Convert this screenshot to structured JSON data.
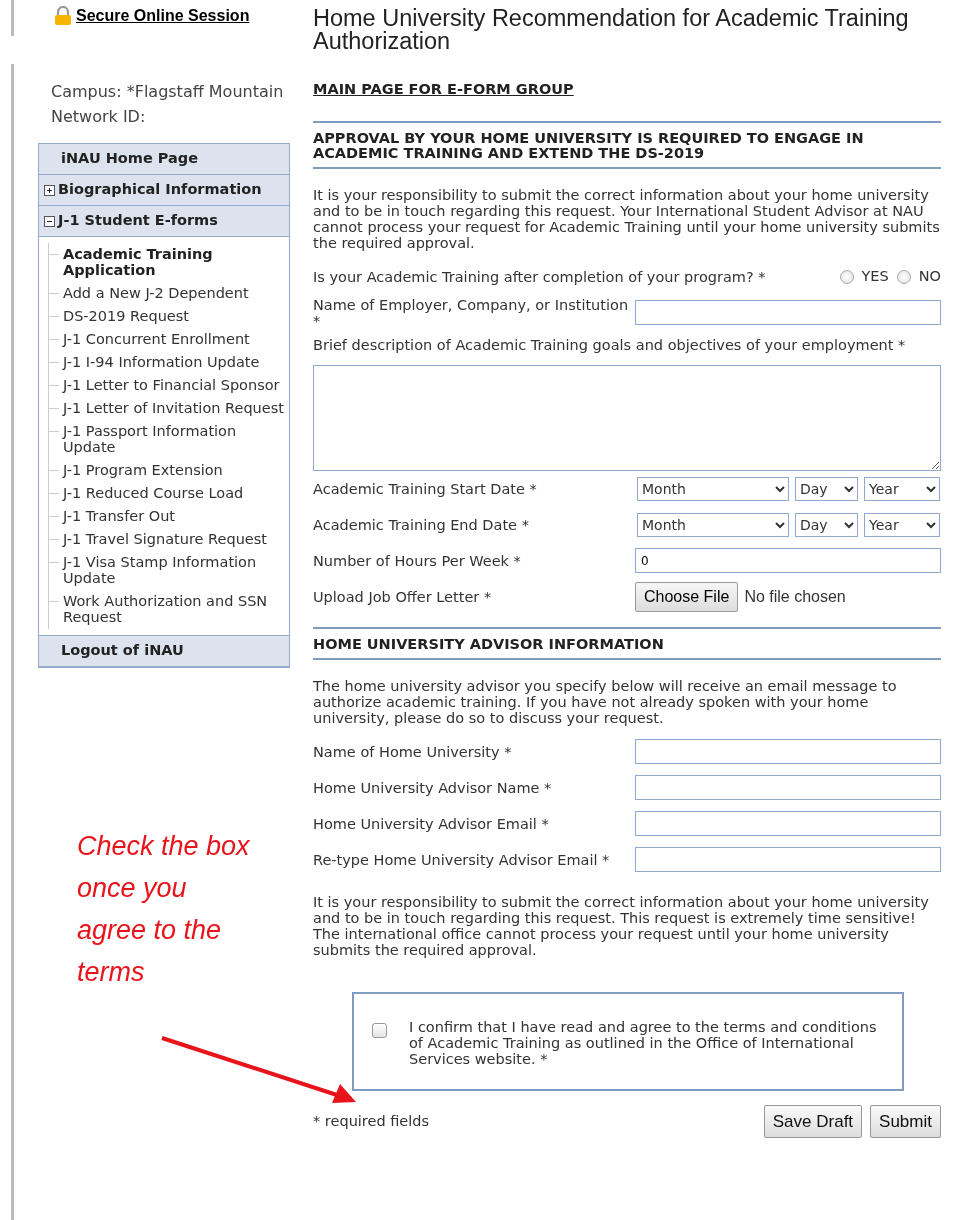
{
  "secure_session": {
    "label": "Secure Online Session"
  },
  "campus": "Campus: *Flagstaff Mountain",
  "network_id": "Network ID:",
  "sidebar": {
    "items": [
      {
        "label": "iNAU Home Page",
        "kind": "link"
      },
      {
        "label": "Biographical Information",
        "kind": "group",
        "expanded": false
      },
      {
        "label": "J-1 Student E-forms",
        "kind": "group",
        "expanded": true,
        "children": [
          {
            "label": "Academic Training Application",
            "selected": true
          },
          {
            "label": "Add a New J-2 Dependent",
            "selected": false
          },
          {
            "label": "DS-2019 Request",
            "selected": false
          },
          {
            "label": "J-1 Concurrent Enrollment",
            "selected": false
          },
          {
            "label": "J-1 I-94 Information Update",
            "selected": false
          },
          {
            "label": "J-1 Letter to Financial Sponsor",
            "selected": false
          },
          {
            "label": "J-1 Letter of Invitation Request",
            "selected": false
          },
          {
            "label": "J-1 Passport Information Update",
            "selected": false
          },
          {
            "label": "J-1 Program Extension",
            "selected": false
          },
          {
            "label": "J-1 Reduced Course Load",
            "selected": false
          },
          {
            "label": "J-1 Transfer Out",
            "selected": false
          },
          {
            "label": "J-1 Travel Signature Request",
            "selected": false
          },
          {
            "label": "J-1 Visa Stamp Information Update",
            "selected": false
          },
          {
            "label": "Work Authorization and SSN Request",
            "selected": false
          }
        ]
      },
      {
        "label": "Logout of iNAU",
        "kind": "link"
      }
    ]
  },
  "annotation": {
    "lines": [
      "Check the box",
      "once you",
      "agree to the",
      "terms"
    ]
  },
  "page_title": "Home University Recommendation for Academic Training Authorization",
  "main_link": "MAIN PAGE FOR E-FORM GROUP",
  "sections": [
    {
      "heading": "APPROVAL BY YOUR HOME UNIVERSITY IS REQUIRED TO ENGAGE IN ACADEMIC TRAINING AND EXTEND THE DS-2019",
      "intro": "It is your responsibility to submit the correct information about your home university and to be in touch regarding this request. Your International Student Advisor at NAU cannot process your request for Academic Training until your home university submits the required approval.",
      "fields": [
        {
          "kind": "radio",
          "label": "Is your Academic Training after completion of your program? *",
          "options": [
            {
              "label": "YES",
              "selected": false
            },
            {
              "label": "NO",
              "selected": false
            }
          ]
        },
        {
          "kind": "text",
          "label": "Name of Employer, Company, or Institution *"
        },
        {
          "kind": "textarea",
          "label": "Brief description of Academic Training goals and objectives of your employment *"
        },
        {
          "kind": "date",
          "label": "Academic Training Start Date *",
          "selects": [
            "Month",
            "Day",
            "Year"
          ]
        },
        {
          "kind": "date",
          "label": "Academic Training End Date *",
          "selects": [
            "Month",
            "Day",
            "Year"
          ]
        },
        {
          "kind": "text",
          "label": "Number of Hours Per Week *",
          "value": "0"
        },
        {
          "kind": "file",
          "label": "Upload Job Offer Letter *",
          "button": "Choose File",
          "status": "No file chosen"
        }
      ]
    },
    {
      "heading": "HOME UNIVERSITY ADVISOR INFORMATION",
      "intro": "The home university advisor you specify below will receive an email message to authorize academic training. If you have not already spoken with your home university, please do so to discuss your request.",
      "fields": [
        {
          "kind": "text",
          "label": "Name of Home University *"
        },
        {
          "kind": "text",
          "label": "Home University Advisor Name *"
        },
        {
          "kind": "text",
          "label": "Home University Advisor Email *"
        },
        {
          "kind": "text",
          "label": "Re-type Home University Advisor Email *"
        }
      ],
      "outro": "It is your responsibility to submit the correct information about your home university and to be in touch regarding this request. This request is extremely time sensitive! The international office cannot process your request until your home university submits the required approval."
    }
  ],
  "confirm": {
    "label": "I confirm that I have read and agree to the terms and conditions of Academic Training as outlined in the Office of International Services website. *",
    "checked": false
  },
  "required_note": "* required fields",
  "buttons": [
    "Save Draft",
    "Submit"
  ]
}
